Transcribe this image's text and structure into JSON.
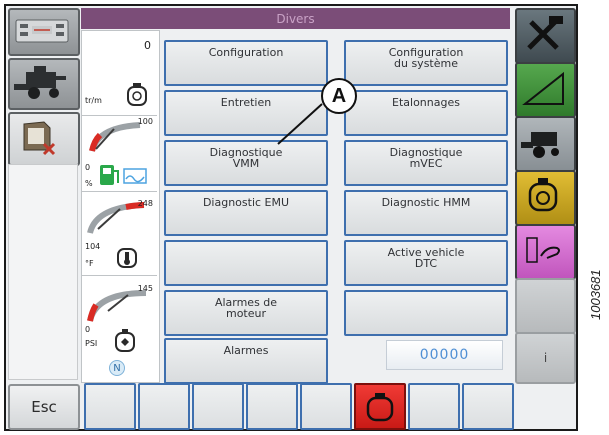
{
  "header": {
    "title": "Divers"
  },
  "left_column": {
    "buttons": [
      {
        "icon": "engine-speed-meter-icon",
        "active": false
      },
      {
        "icon": "combine-harvester-icon",
        "active": false
      },
      {
        "icon": "field-map-icon",
        "active": true
      }
    ],
    "esc_label": "Esc"
  },
  "gauges": {
    "speed_value": "0",
    "speed_unit": "tr/m",
    "fuel_max": "100",
    "fuel_min": "0",
    "fuel_unit": "%",
    "coolant_max": "248",
    "coolant_min": "104",
    "coolant_unit": "°F",
    "oil_max": "145",
    "oil_min": "0",
    "oil_unit": "PSI",
    "neutral_indicator": "N"
  },
  "main_buttons": {
    "configuration": "Configuration",
    "system_config_line1": "Configuration",
    "system_config_line2": "du système",
    "entretien": "Entretien",
    "etalonnages": "Etalonnages",
    "diag_vmm_line1": "Diagnostique",
    "diag_vmm_line2": "VMM",
    "diag_mvec_line1": "Diagnostique",
    "diag_mvec_line2": "mVEC",
    "diag_emu": "Diagnostic EMU",
    "diag_hmm": "Diagnostic HMM",
    "blank_left": "",
    "active_dtc_line1": "Active vehicle",
    "active_dtc_line2": "DTC",
    "engine_alarms_line1": "Alarmes de",
    "engine_alarms_line2": "moteur",
    "blank_right": "",
    "alarms": "Alarmes",
    "counter": "00000"
  },
  "right_column": [
    {
      "icon": "tools-icon",
      "color": "#4f5c63"
    },
    {
      "icon": "slope-icon",
      "color": "#3f8a3a"
    },
    {
      "icon": "combine-harvester-icon",
      "color": "#9ba2a6"
    },
    {
      "icon": "engine-icon",
      "color": "#c9a824"
    },
    {
      "icon": "sos-hand-icon",
      "color": "#d46fd0"
    },
    {
      "icon": "blank",
      "color": "#c4c7c9"
    },
    {
      "icon": "info-icon",
      "label": "i",
      "color": "#c4c7c9"
    }
  ],
  "bottom_row": {
    "active_alarm_color": "#e8231f"
  },
  "callout": {
    "label": "A"
  },
  "figure_id": "1003681"
}
